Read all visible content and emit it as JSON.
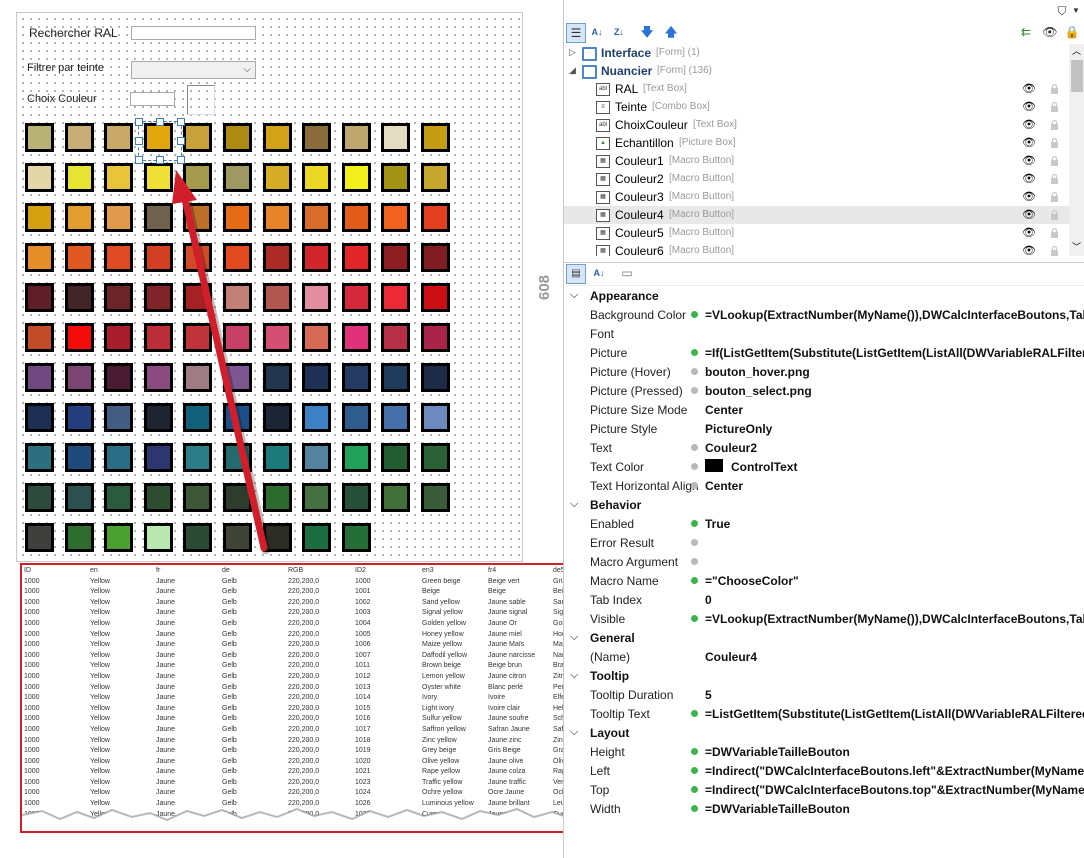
{
  "designer": {
    "search_label": "Rechercher RAL",
    "filter_label": "Filtrer par teinte",
    "color_label": "Choix Couleur",
    "swatch_rows": [
      [
        "#b8b276",
        "#c7ae76",
        "#c8a968",
        "#e3a70e",
        "#c9a13b",
        "#ad8a13",
        "#d3a218",
        "#8a6b3a",
        "#bfa66f",
        "#e3dcc3",
        "#c49d12"
      ],
      [
        "#e3d7a8",
        "#e6e433",
        "#e7c43a",
        "#efdf36",
        "#a59b4d",
        "#9e9861",
        "#d4ac25",
        "#ebd827",
        "#f3ef1d",
        "#a49416",
        "#c5a82b"
      ],
      [
        "#d3a00e",
        "#e29d2f",
        "#df9a4d",
        "#6e624f",
        "#bd6f2a",
        "#e56c14",
        "#e7842a",
        "#d86d29",
        "#e35c1c",
        "#f0621e",
        "#e2401f"
      ],
      [
        "#e48e2a",
        "#e15721",
        "#e04b26",
        "#d23f22",
        "#d34a26",
        "#e14a1f",
        "#ad2b26",
        "#d0252a",
        "#e1262a",
        "#8f1e23",
        "#811c23"
      ],
      [
        "#5f1f29",
        "#412529",
        "#6e252a",
        "#7f2428",
        "#a52124",
        "#c27f75",
        "#b15750",
        "#e28da0",
        "#d52a3b",
        "#ea2a36",
        "#cc0e15"
      ],
      [
        "#c24b2a",
        "#f30d0a",
        "#a81d2c",
        "#bb2e38",
        "#c1343c",
        "#c74068",
        "#d54f74",
        "#d66a56",
        "#e0327b",
        "#b52f46",
        "#a9234a"
      ],
      [
        "#6f4880",
        "#7b4571",
        "#4a1c31",
        "#8b4b7f",
        "#9f7b84",
        "#7c5591",
        "#22364f",
        "#1e3155",
        "#243a63",
        "#1f3b5b",
        "#1d2a48"
      ],
      [
        "#1c2e52",
        "#243e7d",
        "#435c84",
        "#1e2530",
        "#115f79",
        "#1c4f8a",
        "#1d2636",
        "#3c81c4",
        "#2e5c8c",
        "#4870a8",
        "#6c8abd"
      ],
      [
        "#2d6e7f",
        "#1e4b7a",
        "#2b6d84",
        "#2d366e",
        "#2b7d88",
        "#256a6d",
        "#1c7a7a",
        "#53839e",
        "#22a05a",
        "#245c32",
        "#2b6235"
      ],
      [
        "#2d4a3c",
        "#2c4f4f",
        "#2b5b3f",
        "#2e4d30",
        "#3f5739",
        "#2e3c2d",
        "#2b6b2e",
        "#457042",
        "#27503a",
        "#417038",
        "#385d38"
      ],
      [
        "#3f3f3e",
        "#2d6d2e",
        "#4ca02f",
        "#b9e7b0",
        "#2b4a33",
        "#3f4437",
        "#2c2d24",
        "#1c6e40",
        "#266e37"
      ]
    ]
  },
  "table": {
    "headers": [
      "ID",
      "en",
      "fr",
      "de",
      "RGB",
      "ID2",
      "en3",
      "fr4",
      "de5"
    ],
    "rows": [
      [
        "1000",
        "Yellow",
        "Jaune",
        "Gelb",
        "220,200,0",
        "1000",
        "Green beige",
        "Beige vert",
        "Grünbeige"
      ],
      [
        "1000",
        "Yellow",
        "Jaune",
        "Gelb",
        "220,200,0",
        "1001",
        "Beige",
        "Beige",
        "Beige"
      ],
      [
        "1000",
        "Yellow",
        "Jaune",
        "Gelb",
        "220,200,0",
        "1002",
        "Sand yellow",
        "Jaune sable",
        "Sandgelb"
      ],
      [
        "1000",
        "Yellow",
        "Jaune",
        "Gelb",
        "220,200,0",
        "1003",
        "Signal yellow",
        "Jaune signal",
        "Signalgelb"
      ],
      [
        "1000",
        "Yellow",
        "Jaune",
        "Gelb",
        "220,200,0",
        "1004",
        "Golden yellow",
        "Jaune Or",
        "Goldgelb"
      ],
      [
        "1000",
        "Yellow",
        "Jaune",
        "Gelb",
        "220,200,0",
        "1005",
        "Honey yellow",
        "Jaune miel",
        "Honiggelb"
      ],
      [
        "1000",
        "Yellow",
        "Jaune",
        "Gelb",
        "220,200,0",
        "1006",
        "Maize yellow",
        "Jaune Maïs",
        "Maisgelb"
      ],
      [
        "1000",
        "Yellow",
        "Jaune",
        "Gelb",
        "220,200,0",
        "1007",
        "Daffodil yellow",
        "Jaune narcisse",
        "Narzissengelb"
      ],
      [
        "1000",
        "Yellow",
        "Jaune",
        "Gelb",
        "220,200,0",
        "1011",
        "Brown beige",
        "Beige brun",
        "Braunbeige"
      ],
      [
        "1000",
        "Yellow",
        "Jaune",
        "Gelb",
        "220,200,0",
        "1012",
        "Lemon yellow",
        "Jaune citron",
        "Zitronengelb"
      ],
      [
        "1000",
        "Yellow",
        "Jaune",
        "Gelb",
        "220,200,0",
        "1013",
        "Oyster white",
        "Blanc perlé",
        "Perlweiß"
      ],
      [
        "1000",
        "Yellow",
        "Jaune",
        "Gelb",
        "220,200,0",
        "1014",
        "Ivory",
        "Ivoire",
        "Elfenbein"
      ],
      [
        "1000",
        "Yellow",
        "Jaune",
        "Gelb",
        "220,200,0",
        "1015",
        "Light ivory",
        "Ivoire clair",
        "Hellelfenbein"
      ],
      [
        "1000",
        "Yellow",
        "Jaune",
        "Gelb",
        "220,200,0",
        "1016",
        "Sulfur yellow",
        "Jaune soufre",
        "Schwefelgelb"
      ],
      [
        "1000",
        "Yellow",
        "Jaune",
        "Gelb",
        "220,200,0",
        "1017",
        "Saffron yellow",
        "Safran Jaune",
        "Safrangelb"
      ],
      [
        "1000",
        "Yellow",
        "Jaune",
        "Gelb",
        "220,200,0",
        "1018",
        "Zinc yellow",
        "Jaune zinc",
        "Zinkgelb"
      ],
      [
        "1000",
        "Yellow",
        "Jaune",
        "Gelb",
        "220,200,0",
        "1019",
        "Grey beige",
        "Gris Beige",
        "Graubeige"
      ],
      [
        "1000",
        "Yellow",
        "Jaune",
        "Gelb",
        "220,200,0",
        "1020",
        "Olive yellow",
        "Jaune olive",
        "Olivgelb"
      ],
      [
        "1000",
        "Yellow",
        "Jaune",
        "Gelb",
        "220,200,0",
        "1021",
        "Rape yellow",
        "Jaune colza",
        "Rapsgelb"
      ],
      [
        "1000",
        "Yellow",
        "Jaune",
        "Gelb",
        "220,200,0",
        "1023",
        "Traffic yellow",
        "Jaune traffic",
        "Verkehrsgelb"
      ],
      [
        "1000",
        "Yellow",
        "Jaune",
        "Gelb",
        "220,200,0",
        "1024",
        "Ochre yellow",
        "Ocre Jaune",
        "Ockergelb"
      ],
      [
        "1000",
        "Yellow",
        "Jaune",
        "Gelb",
        "220,200,0",
        "1026",
        "Luminous yellow",
        "Jaune brillant",
        "Leuchtgelb"
      ],
      [
        "1000",
        "Yellow",
        "Jaune",
        "Gelb",
        "220,200,0",
        "1027",
        "Curry",
        "Jaune curry",
        "Currygelb"
      ]
    ]
  },
  "size_label": "608",
  "tree": {
    "nodes": [
      {
        "name": "Interface",
        "type": "[Form] (1)",
        "level": 0,
        "expander": "▷",
        "kind": "form"
      },
      {
        "name": "Nuancier",
        "type": "[Form] (136)",
        "level": 0,
        "expander": "◢",
        "kind": "form"
      },
      {
        "name": "RAL",
        "type": "[Text Box]",
        "level": 1,
        "kind": "textbox"
      },
      {
        "name": "Teinte",
        "type": "[Combo Box]",
        "level": 1,
        "kind": "combo"
      },
      {
        "name": "ChoixCouleur",
        "type": "[Text Box]",
        "level": 1,
        "kind": "textbox"
      },
      {
        "name": "Echantillon",
        "type": "[Picture Box]",
        "level": 1,
        "kind": "picture"
      },
      {
        "name": "Couleur1",
        "type": "[Macro Button]",
        "level": 1,
        "kind": "button"
      },
      {
        "name": "Couleur2",
        "type": "[Macro Button]",
        "level": 1,
        "kind": "button"
      },
      {
        "name": "Couleur3",
        "type": "[Macro Button]",
        "level": 1,
        "kind": "button"
      },
      {
        "name": "Couleur4",
        "type": "[Macro Button]",
        "level": 1,
        "kind": "button",
        "selected": true
      },
      {
        "name": "Couleur5",
        "type": "[Macro Button]",
        "level": 1,
        "kind": "button"
      },
      {
        "name": "Couleur6",
        "type": "[Macro Button]",
        "level": 1,
        "kind": "button"
      }
    ]
  },
  "properties": {
    "rows": [
      {
        "cat": "Appearance"
      },
      {
        "name": "Background Color",
        "value": "=VLookup(ExtractNumber(MyName()),DWCalcInterfaceBoutons,Tabl",
        "dot": "green"
      },
      {
        "name": "Font",
        "value": "",
        "dot": "none"
      },
      {
        "name": "Picture",
        "value": "=If(ListGetItem(Substitute(ListGetItem(ListAll(DWVariableRALFiltere",
        "dot": "green"
      },
      {
        "name": "Picture (Hover)",
        "value": "bouton_hover.png",
        "dot": "grey"
      },
      {
        "name": "Picture (Pressed)",
        "value": "bouton_select.png",
        "dot": "grey"
      },
      {
        "name": "Picture Size Mode",
        "value": "Center",
        "dot": "none"
      },
      {
        "name": "Picture Style",
        "value": "PictureOnly",
        "dot": "none"
      },
      {
        "name": "Text",
        "value": "Couleur2",
        "dot": "grey"
      },
      {
        "name": "Text Color",
        "value": "ControlText",
        "dot": "grey",
        "swatch": "#000000"
      },
      {
        "name": "Text Horizontal Align",
        "value": "Center",
        "dot": "grey"
      },
      {
        "cat": "Behavior"
      },
      {
        "name": "Enabled",
        "value": "True",
        "dot": "green"
      },
      {
        "name": "Error Result",
        "value": "",
        "dot": "grey"
      },
      {
        "name": "Macro Argument",
        "value": "",
        "dot": "grey"
      },
      {
        "name": "Macro Name",
        "value": "=\"ChooseColor\"",
        "dot": "green"
      },
      {
        "name": "Tab Index",
        "value": "0",
        "dot": "none"
      },
      {
        "name": "Visible",
        "value": "=VLookup(ExtractNumber(MyName()),DWCalcInterfaceBoutons,Tabl",
        "dot": "green"
      },
      {
        "cat": "General"
      },
      {
        "name": "(Name)",
        "value": "Couleur4",
        "dot": "none"
      },
      {
        "cat": "Tooltip"
      },
      {
        "name": "Tooltip Duration",
        "value": "5",
        "dot": "none"
      },
      {
        "name": "Tooltip Text",
        "value": "=ListGetItem(Substitute(ListGetItem(ListAll(DWVariableRALFiltered",
        "dot": "green"
      },
      {
        "cat": "Layout"
      },
      {
        "name": "Height",
        "value": "=DWVariableTailleBouton",
        "dot": "green"
      },
      {
        "name": "Left",
        "value": "=Indirect(\"DWCalcInterfaceBoutons.left\"&ExtractNumber(MyName",
        "dot": "green"
      },
      {
        "name": "Top",
        "value": "=Indirect(\"DWCalcInterfaceBoutons.top\"&ExtractNumber(MyName",
        "dot": "green"
      },
      {
        "name": "Width",
        "value": "=DWVariableTailleBouton",
        "dot": "green"
      }
    ]
  }
}
